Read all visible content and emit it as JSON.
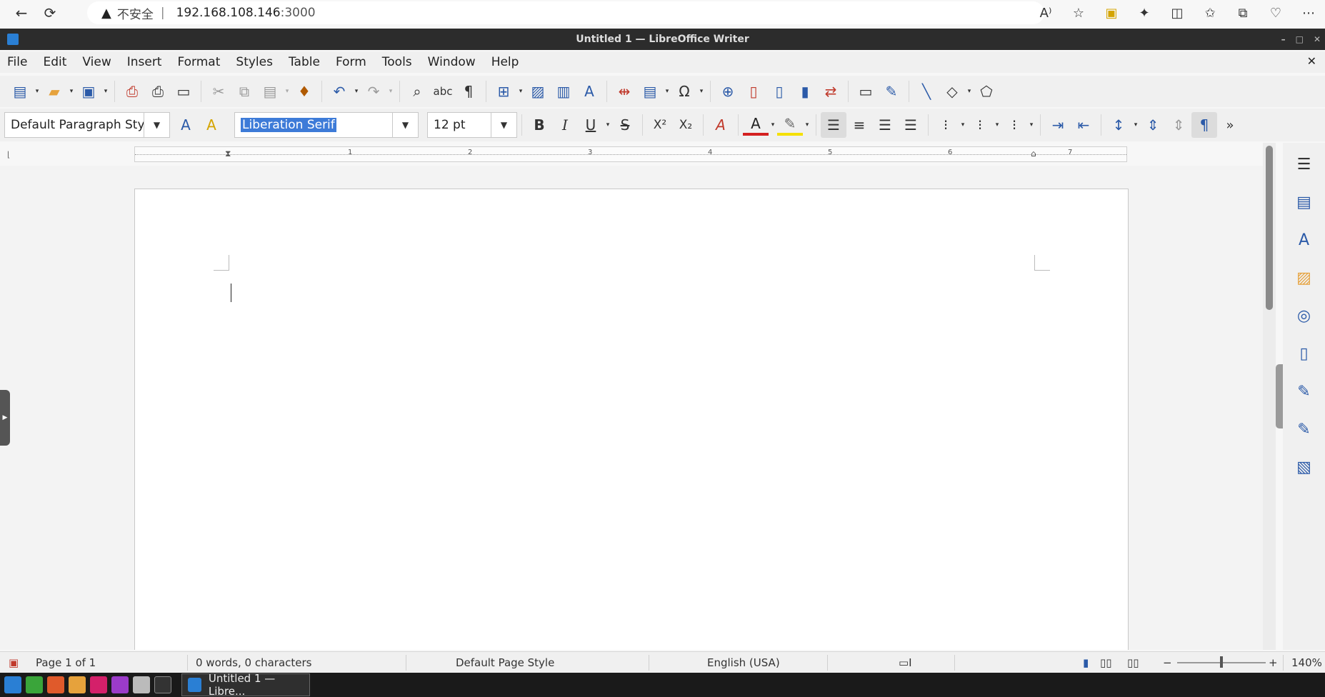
{
  "browser": {
    "back_icon": "arrow-left-icon",
    "refresh_icon": "refresh-icon",
    "insecure_label": "不安全",
    "separator": "|",
    "url_host": "192.168.108.146",
    "url_port": ":3000"
  },
  "window": {
    "title": "Untitled 1 — LibreOffice Writer"
  },
  "menu": [
    "File",
    "Edit",
    "View",
    "Insert",
    "Format",
    "Styles",
    "Table",
    "Form",
    "Tools",
    "Window",
    "Help"
  ],
  "formatting": {
    "paragraph_style": "Default Paragraph Styl",
    "font_name": "Liberation Serif",
    "font_size": "12 pt"
  },
  "ruler": {
    "numbers": [
      "1",
      "2",
      "3",
      "4",
      "5",
      "6",
      "7"
    ]
  },
  "status": {
    "page": "Page 1 of 1",
    "words": "0 words, 0 characters",
    "page_style": "Default Page Style",
    "language": "English (USA)",
    "zoom_minus": "−",
    "zoom_plus": "+",
    "zoom": "140%"
  },
  "taskbar": {
    "task_label": "Untitled 1 — Libre..."
  },
  "colors": {
    "accent": "#2b5aa8",
    "selection": "#3d7bd8",
    "font_color_swatch": "#d42020",
    "highlight_swatch": "#f5e000"
  }
}
